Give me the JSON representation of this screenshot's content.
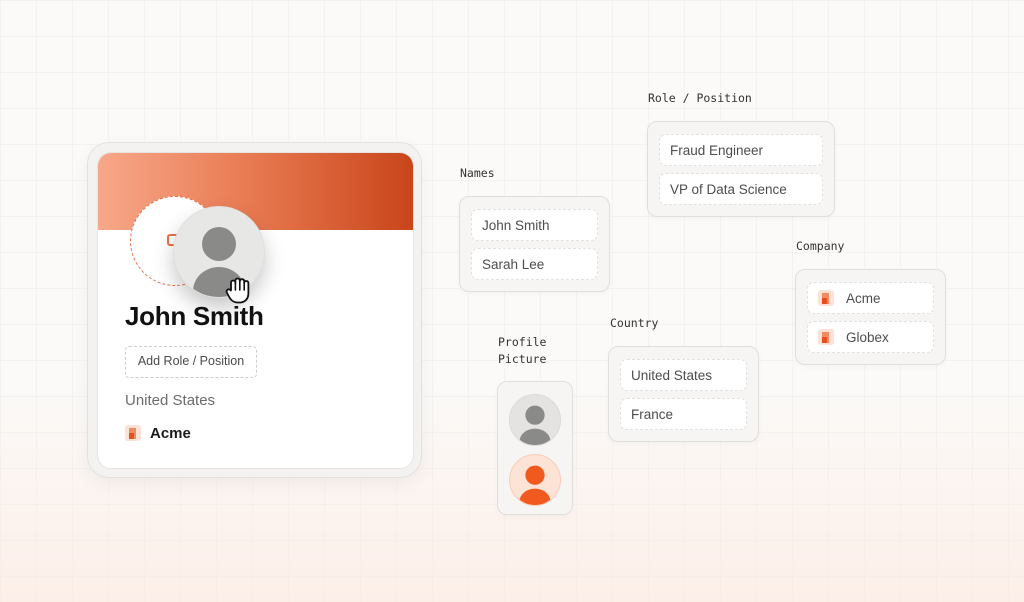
{
  "profile_card": {
    "name": "John Smith",
    "role_button_label": "Add Role / Position",
    "country": "United States",
    "company": "Acme"
  },
  "groups": {
    "names": {
      "label": "Names",
      "items": [
        "John Smith",
        "Sarah Lee"
      ]
    },
    "role": {
      "label": "Role / Position",
      "items": [
        "Fraud Engineer",
        "VP of Data Science"
      ]
    },
    "company": {
      "label": "Company",
      "items": [
        "Acme",
        "Globex"
      ]
    },
    "country": {
      "label": "Country",
      "items": [
        "United States",
        "France"
      ]
    },
    "profile_picture": {
      "label_line1": "Profile",
      "label_line2": "Picture",
      "items": [
        "gray-avatar",
        "orange-avatar"
      ]
    }
  },
  "colors": {
    "accent": "#e8734b",
    "banner_start": "#f7a88a",
    "banner_end": "#c9451a",
    "avatar_gray": "#8a8a88",
    "avatar_orange": "#f05a1f"
  },
  "icons": {
    "cursor": "grab-hand-cursor-icon",
    "upload": "image-upload-icon",
    "company_logo": "company-logo-icon"
  }
}
